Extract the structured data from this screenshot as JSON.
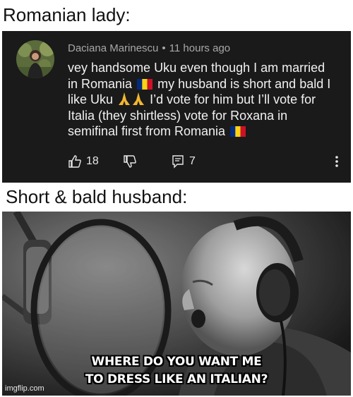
{
  "captions": {
    "top": "Romanian lady:",
    "middle": "Short & bald husband:"
  },
  "comment": {
    "author": "Daciana Marinescu",
    "separator": "•",
    "time": "11 hours ago",
    "lines": [
      "vey handsome Uku even though I am married",
      "in Romania",
      "my husband is short and bald I",
      "like Uku",
      "I’d vote for him but I’ll vote for",
      "Italia (they shirtless) vote for Roxana in",
      "semifinal first from Romania"
    ],
    "likes": "18",
    "replies": "7",
    "icons": {
      "like": "thumbs-up-icon",
      "dislike": "thumbs-down-icon",
      "reply": "comment-icon",
      "more": "more-vertical-icon",
      "flag": "romania-flag-icon",
      "pray": "folded-hands-icon"
    },
    "colors": {
      "panel": "#1a1a1a",
      "author": "#a8a8a8",
      "text": "#f1f1f1"
    }
  },
  "meme": {
    "line1": "WHERE DO YOU WANT ME",
    "line2": "TO DRESS LIKE AN ITALIAN?",
    "watermark": "imgflip.com"
  }
}
